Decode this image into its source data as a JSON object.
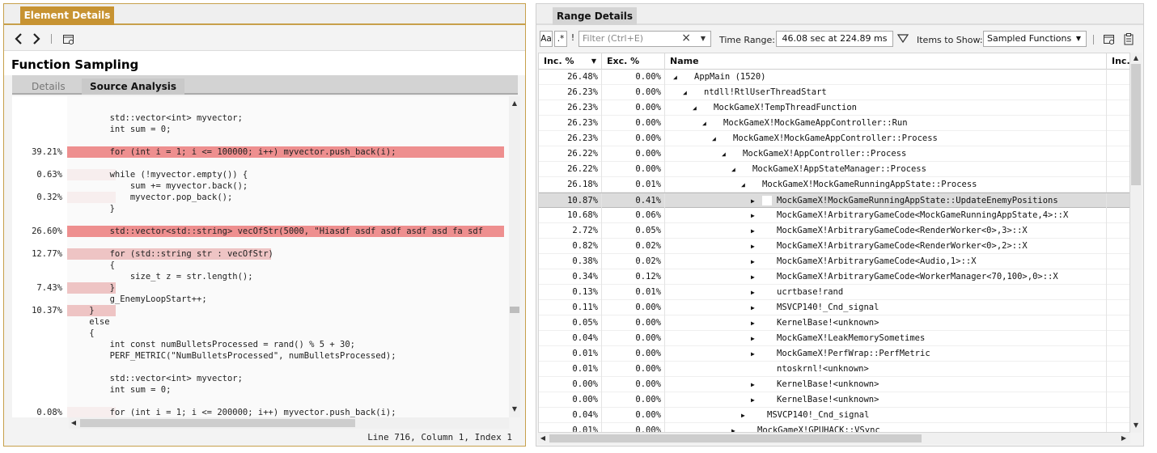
{
  "left": {
    "tab": "Element Details",
    "title": "Function Sampling",
    "subtabs": [
      "Details",
      "Source Analysis"
    ],
    "status": "Line 716, Column 1, Index 1",
    "code": [
      {
        "pct": "",
        "text": "        std::vector<int> myvector;",
        "heat": 0
      },
      {
        "pct": "",
        "text": "        int sum = 0;",
        "heat": 0
      },
      {
        "pct": "",
        "text": "",
        "heat": 0
      },
      {
        "pct": "39.21%",
        "text": "        for (int i = 1; i <= 100000; i++) myvector.push_back(i);",
        "heat": 3
      },
      {
        "pct": "",
        "text": "",
        "heat": 0
      },
      {
        "pct": "0.63%",
        "text": "        while (!myvector.empty()) {",
        "heat": 1
      },
      {
        "pct": "",
        "text": "            sum += myvector.back();",
        "heat": 0
      },
      {
        "pct": "0.32%",
        "text": "            myvector.pop_back();",
        "heat": 1
      },
      {
        "pct": "",
        "text": "        }",
        "heat": 0
      },
      {
        "pct": "",
        "text": "",
        "heat": 0
      },
      {
        "pct": "26.60%",
        "text": "        std::vector<std::string> vecOfStr(5000, \"Hiasdf asdf asdf asdf asd fa sdf",
        "heat": 3
      },
      {
        "pct": "",
        "text": "",
        "heat": 0
      },
      {
        "pct": "12.77%",
        "text": "        for (std::string str : vecOfStr)",
        "heat": 2
      },
      {
        "pct": "",
        "text": "        {",
        "heat": 0
      },
      {
        "pct": "",
        "text": "            size_t z = str.length();",
        "heat": 0
      },
      {
        "pct": "7.43%",
        "text": "        }",
        "heat": 2
      },
      {
        "pct": "",
        "text": "        g_EnemyLoopStart++;",
        "heat": 0
      },
      {
        "pct": "10.37%",
        "text": "    }",
        "heat": 2
      },
      {
        "pct": "",
        "text": "    else",
        "heat": 0
      },
      {
        "pct": "",
        "text": "    {",
        "heat": 0
      },
      {
        "pct": "",
        "text": "        int const numBulletsProcessed = rand() % 5 + 30;",
        "heat": 0
      },
      {
        "pct": "",
        "text": "        PERF_METRIC(\"NumBulletsProcessed\", numBulletsProcessed);",
        "heat": 0
      },
      {
        "pct": "",
        "text": "",
        "heat": 0
      },
      {
        "pct": "",
        "text": "        std::vector<int> myvector;",
        "heat": 0
      },
      {
        "pct": "",
        "text": "        int sum = 0;",
        "heat": 0
      },
      {
        "pct": "",
        "text": "",
        "heat": 0
      },
      {
        "pct": "0.08%",
        "text": "        for (int i = 1; i <= 200000; i++) myvector.push_back(i);",
        "heat": 1
      }
    ]
  },
  "right": {
    "tab": "Range Details",
    "toolbar": {
      "case_label": "Aa",
      "regex_label": ".*",
      "bang_label": "!",
      "filter_placeholder": "Filter (Ctrl+E)",
      "time_range_label": "Time Range:",
      "time_range_value": "46.08 sec at 224.89 ms",
      "items_label": "Items to Show:",
      "items_value": "Sampled Functions"
    },
    "columns": [
      "Inc. %",
      "Exc. %",
      "Name",
      "Inc."
    ],
    "rows": [
      {
        "inc": "26.48%",
        "exc": "0.00%",
        "depth": 0,
        "tri": "open",
        "name": "AppMain (1520)"
      },
      {
        "inc": "26.23%",
        "exc": "0.00%",
        "depth": 1,
        "tri": "open",
        "name": "ntdll!RtlUserThreadStart"
      },
      {
        "inc": "26.23%",
        "exc": "0.00%",
        "depth": 2,
        "tri": "open",
        "name": "MockGameX!TempThreadFunction"
      },
      {
        "inc": "26.23%",
        "exc": "0.00%",
        "depth": 3,
        "tri": "open",
        "name": "MockGameX!MockGameAppController::Run"
      },
      {
        "inc": "26.23%",
        "exc": "0.00%",
        "depth": 4,
        "tri": "open",
        "name": "MockGameX!MockGameAppController::Process"
      },
      {
        "inc": "26.22%",
        "exc": "0.00%",
        "depth": 5,
        "tri": "open",
        "name": "MockGameX!AppController::Process"
      },
      {
        "inc": "26.22%",
        "exc": "0.00%",
        "depth": 6,
        "tri": "open",
        "name": "MockGameX!AppStateManager::Process"
      },
      {
        "inc": "26.18%",
        "exc": "0.01%",
        "depth": 7,
        "tri": "open",
        "name": "MockGameX!MockGameRunningAppState::Process"
      },
      {
        "inc": "10.87%",
        "exc": "0.41%",
        "depth": 8,
        "tri": "closed",
        "name": "MockGameX!MockGameRunningAppState::UpdateEnemyPositions",
        "selected": true
      },
      {
        "inc": "10.68%",
        "exc": "0.06%",
        "depth": 8,
        "tri": "closed",
        "name": "MockGameX!ArbitraryGameCode<MockGameRunningAppState,4>::X"
      },
      {
        "inc": "2.72%",
        "exc": "0.05%",
        "depth": 8,
        "tri": "closed",
        "name": "MockGameX!ArbitraryGameCode<RenderWorker<0>,3>::X"
      },
      {
        "inc": "0.82%",
        "exc": "0.02%",
        "depth": 8,
        "tri": "closed",
        "name": "MockGameX!ArbitraryGameCode<RenderWorker<0>,2>::X"
      },
      {
        "inc": "0.38%",
        "exc": "0.02%",
        "depth": 8,
        "tri": "closed",
        "name": "MockGameX!ArbitraryGameCode<Audio,1>::X"
      },
      {
        "inc": "0.34%",
        "exc": "0.12%",
        "depth": 8,
        "tri": "closed",
        "name": "MockGameX!ArbitraryGameCode<WorkerManager<70,100>,0>::X"
      },
      {
        "inc": "0.13%",
        "exc": "0.01%",
        "depth": 8,
        "tri": "closed",
        "name": "ucrtbase!rand"
      },
      {
        "inc": "0.11%",
        "exc": "0.00%",
        "depth": 8,
        "tri": "closed",
        "name": "MSVCP140!_Cnd_signal"
      },
      {
        "inc": "0.05%",
        "exc": "0.00%",
        "depth": 8,
        "tri": "closed",
        "name": "KernelBase!<unknown>"
      },
      {
        "inc": "0.04%",
        "exc": "0.00%",
        "depth": 8,
        "tri": "closed",
        "name": "MockGameX!LeakMemorySometimes"
      },
      {
        "inc": "0.01%",
        "exc": "0.00%",
        "depth": 8,
        "tri": "closed",
        "name": "MockGameX!PerfWrap::PerfMetric"
      },
      {
        "inc": "0.01%",
        "exc": "0.00%",
        "depth": 8,
        "tri": "none",
        "name": "ntoskrnl!<unknown>"
      },
      {
        "inc": "0.00%",
        "exc": "0.00%",
        "depth": 8,
        "tri": "closed",
        "name": "KernelBase!<unknown>"
      },
      {
        "inc": "0.00%",
        "exc": "0.00%",
        "depth": 8,
        "tri": "closed",
        "name": "KernelBase!<unknown>"
      },
      {
        "inc": "0.04%",
        "exc": "0.00%",
        "depth": 7,
        "tri": "closed",
        "name": "MSVCP140!_Cnd_signal"
      },
      {
        "inc": "0.01%",
        "exc": "0.00%",
        "depth": 6,
        "tri": "closed",
        "name": "MockGameX!GPUHACK::VSync"
      }
    ]
  }
}
